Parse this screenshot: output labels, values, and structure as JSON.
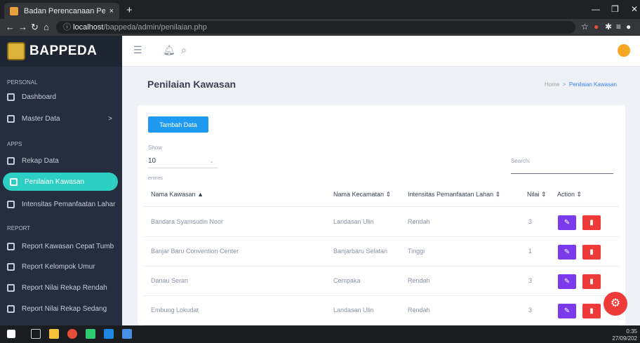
{
  "browser": {
    "tab_title": "Badan Perencanaan Pembangun...",
    "tab_close": "×",
    "new_tab": "+",
    "url_host": "localhost",
    "url_path": "/bappeda/admin/penilaian.php"
  },
  "sidebar": {
    "brand": "BAPPEDA",
    "sections": [
      {
        "label": "PERSONAL"
      },
      {
        "label": "Apps"
      },
      {
        "label": "Report"
      }
    ],
    "items": [
      {
        "label": "Dashboard"
      },
      {
        "label": "Master Data",
        "chevron": ">"
      },
      {
        "label": "Rekap Data"
      },
      {
        "label": "Penilaian Kawasan",
        "active": true
      },
      {
        "label": "Intensitas Pemanfaatan Lahar"
      },
      {
        "label": "Report Kawasan Cepat Tumb"
      },
      {
        "label": "Report Kelompok Umur"
      },
      {
        "label": "Report Nilai Rekap Rendah"
      },
      {
        "label": "Report Nilai Rekap Sedang"
      }
    ]
  },
  "page": {
    "title": "Penilaian Kawasan",
    "breadcrumb_home": "Home",
    "breadcrumb_sep": ">",
    "breadcrumb_current": "Penilaian Kawasan"
  },
  "table_controls": {
    "add_button": "Tambah Data",
    "show_label": "Show",
    "show_value": "10",
    "entries_label": "entries",
    "search_label": "Search:"
  },
  "table": {
    "columns": [
      {
        "label": "Nama Kawasan",
        "sort": "▲"
      },
      {
        "label": "Nama Kecamatan",
        "sort": "⇕"
      },
      {
        "label": "Intensitas Pemanfaatan Lahan",
        "sort": "⇕"
      },
      {
        "label": "Nilai",
        "sort": "⇕"
      },
      {
        "label": "Action",
        "sort": "⇕"
      }
    ],
    "rows": [
      {
        "kawasan": "Bandara Syamsudin Noor",
        "kecamatan": "Landasan Ulin",
        "intensitas": "Rendah",
        "nilai": "3"
      },
      {
        "kawasan": "Banjar Baru Convention Center",
        "kecamatan": "Banjarbaru Selatan",
        "intensitas": "Tinggi",
        "nilai": "1"
      },
      {
        "kawasan": "Danau Seran",
        "kecamatan": "Cempaka",
        "intensitas": "Rendah",
        "nilai": "3"
      },
      {
        "kawasan": "Embung Lokudat",
        "kecamatan": "Landasan Ulin",
        "intensitas": "Rendah",
        "nilai": "3"
      }
    ]
  },
  "taskbar": {
    "time": "0:35",
    "date": "27/09/202"
  },
  "colors": {
    "sidebar_bg": "#252e3e",
    "active_item": "#2ecfc3",
    "primary_button": "#1e9bf0",
    "edit_button": "#7c3aed",
    "delete_button": "#ef3a3a"
  },
  "icons": {
    "edit": "pencil-icon",
    "delete": "trash-icon",
    "fab": "gear-icon",
    "bell": "bell-icon",
    "search": "search-icon",
    "menu": "hamburger-icon"
  }
}
